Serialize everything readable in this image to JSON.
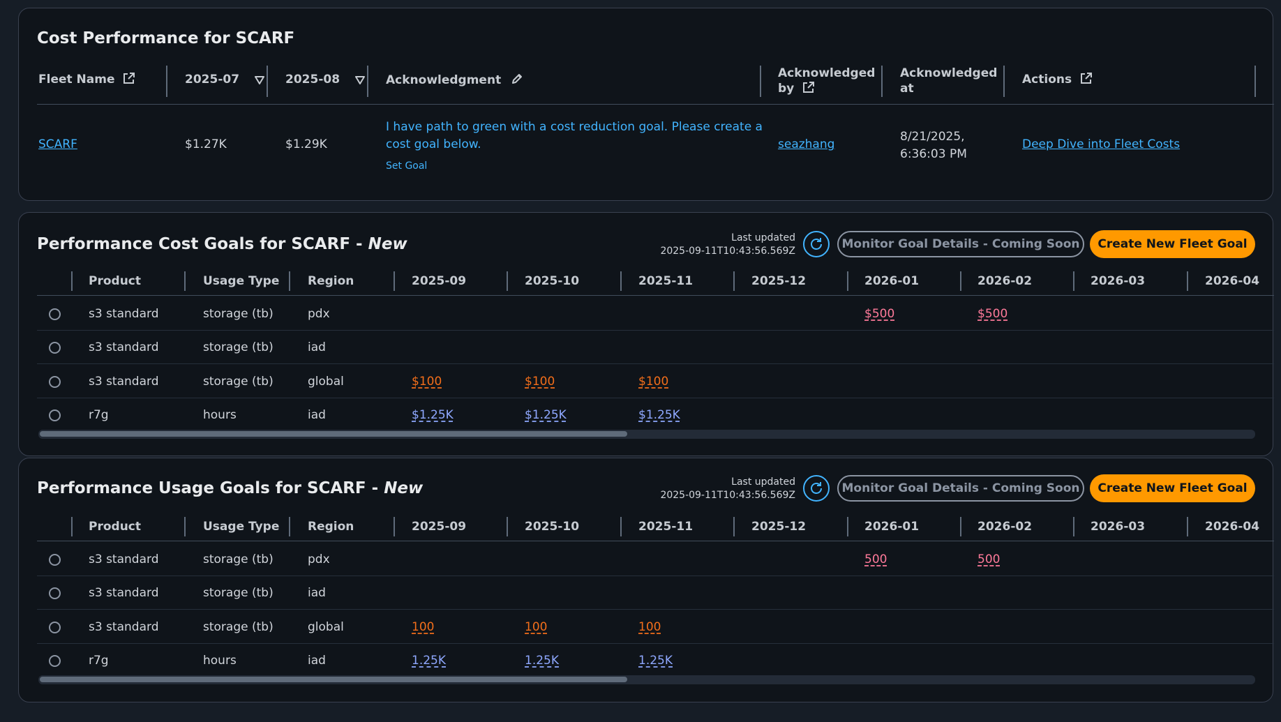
{
  "cost_performance": {
    "title": "Cost Performance for SCARF",
    "headers": {
      "fleet_name": "Fleet Name",
      "month1": "2025-07",
      "month2": "2025-08",
      "acknowledgment": "Acknowledgment",
      "ack_by_line1": "Acknowledged",
      "ack_by_line2": "by",
      "ack_at_line1": "Acknowledged",
      "ack_at_line2": "at",
      "actions": "Actions"
    },
    "row": {
      "fleet": "SCARF",
      "month1_value": "$1.27K",
      "month2_value": "$1.29K",
      "ack_line1": "I have path to green with a cost reduction goal. Please create a",
      "ack_line2": "cost goal below.",
      "set_goal": "Set Goal",
      "ack_by": "seazhang",
      "ack_at_line1": "8/21/2025,",
      "ack_at_line2": "6:36:03 PM",
      "action_link": "Deep Dive into Fleet Costs"
    }
  },
  "cost_goals": {
    "title": "Performance Cost Goals for SCARF - ",
    "title_new": "New",
    "last_updated_label": "Last updated",
    "last_updated_value": "2025-09-11T10:43:56.569Z",
    "monitor_button": "Monitor Goal Details - Coming Soon",
    "create_button": "Create New Fleet Goal",
    "columns": [
      "Product",
      "Usage Type",
      "Region",
      "2025-09",
      "2025-10",
      "2025-11",
      "2025-12",
      "2026-01",
      "2026-02",
      "2026-03",
      "2026-04"
    ],
    "rows": [
      {
        "product": "s3 standard",
        "usage": "storage (tb)",
        "region": "pdx",
        "values": [
          "",
          "",
          "",
          "",
          "$500",
          "$500",
          "",
          ""
        ]
      },
      {
        "product": "s3 standard",
        "usage": "storage (tb)",
        "region": "iad",
        "values": [
          "",
          "",
          "",
          "",
          "",
          "",
          "",
          ""
        ]
      },
      {
        "product": "s3 standard",
        "usage": "storage (tb)",
        "region": "global",
        "values": [
          "$100",
          "$100",
          "$100",
          "",
          "",
          "",
          "",
          ""
        ]
      },
      {
        "product": "r7g",
        "usage": "hours",
        "region": "iad",
        "values": [
          "$1.25K",
          "$1.25K",
          "$1.25K",
          "",
          "",
          "",
          "",
          ""
        ]
      }
    ]
  },
  "usage_goals": {
    "title": "Performance Usage Goals for SCARF - ",
    "title_new": "New",
    "last_updated_label": "Last updated",
    "last_updated_value": "2025-09-11T10:43:56.569Z",
    "monitor_button": "Monitor Goal Details - Coming Soon",
    "create_button": "Create New Fleet Goal",
    "columns": [
      "Product",
      "Usage Type",
      "Region",
      "2025-09",
      "2025-10",
      "2025-11",
      "2025-12",
      "2026-01",
      "2026-02",
      "2026-03",
      "2026-04"
    ],
    "rows": [
      {
        "product": "s3 standard",
        "usage": "storage (tb)",
        "region": "pdx",
        "values": [
          "",
          "",
          "",
          "",
          "500",
          "500",
          "",
          ""
        ]
      },
      {
        "product": "s3 standard",
        "usage": "storage (tb)",
        "region": "iad",
        "values": [
          "",
          "",
          "",
          "",
          "",
          "",
          "",
          ""
        ]
      },
      {
        "product": "s3 standard",
        "usage": "storage (tb)",
        "region": "global",
        "values": [
          "100",
          "100",
          "100",
          "",
          "",
          "",
          "",
          ""
        ]
      },
      {
        "product": "r7g",
        "usage": "hours",
        "region": "iad",
        "values": [
          "1.25K",
          "1.25K",
          "1.25K",
          "",
          "",
          "",
          "",
          ""
        ]
      }
    ]
  },
  "colors": {
    "page_bg": "#161d26",
    "panel_bg": "#0f141a",
    "link": "#42b4ff",
    "primary_button": "#ff9900",
    "value_pink": "#ff7a9a",
    "value_orange": "#f26e1a",
    "value_blue": "#8fa8ff"
  },
  "icons": [
    "external-link-icon",
    "filter-caret-icon",
    "edit-pencil-icon",
    "refresh-icon",
    "radio-button"
  ]
}
